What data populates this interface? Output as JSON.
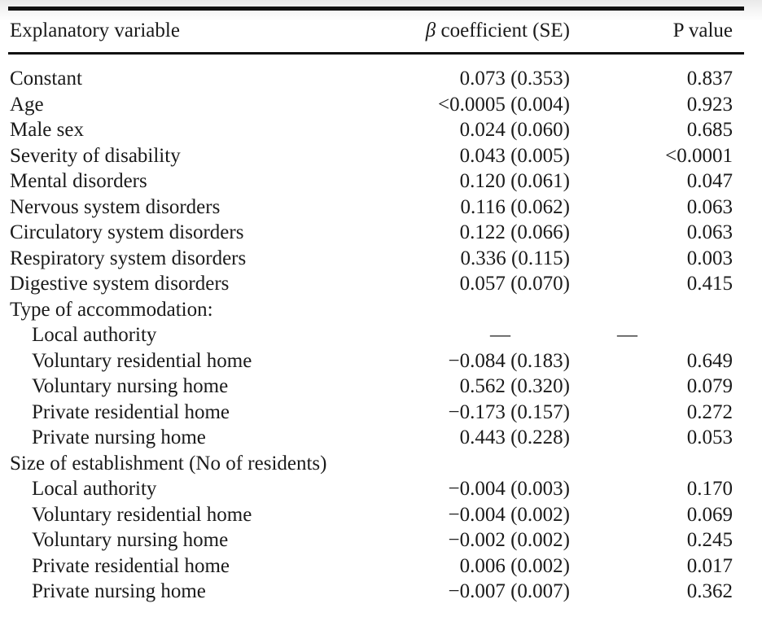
{
  "table": {
    "columns": [
      {
        "key": "variable",
        "label": "Explanatory variable",
        "align": "left"
      },
      {
        "key": "beta",
        "label_prefix": "β",
        "label_rest": " coefficient (SE)",
        "align": "right"
      },
      {
        "key": "p",
        "label": "P value",
        "align": "right"
      }
    ],
    "rows": [
      {
        "variable": "Constant",
        "indent": false,
        "beta": "0.073 (0.353)",
        "p": "0.837"
      },
      {
        "variable": "Age",
        "indent": false,
        "beta": "<0.0005 (0.004)",
        "p": "0.923"
      },
      {
        "variable": "Male sex",
        "indent": false,
        "beta": "0.024 (0.060)",
        "p": "0.685"
      },
      {
        "variable": "Severity of disability",
        "indent": false,
        "beta": "0.043 (0.005)",
        "p": "<0.0001"
      },
      {
        "variable": "Mental disorders",
        "indent": false,
        "beta": "0.120 (0.061)",
        "p": "0.047"
      },
      {
        "variable": "Nervous system disorders",
        "indent": false,
        "beta": "0.116 (0.062)",
        "p": "0.063"
      },
      {
        "variable": "Circulatory system disorders",
        "indent": false,
        "beta": "0.122 (0.066)",
        "p": "0.063"
      },
      {
        "variable": "Respiratory system disorders",
        "indent": false,
        "beta": "0.336 (0.115)",
        "p": "0.003"
      },
      {
        "variable": "Digestive system disorders",
        "indent": false,
        "beta": "0.057 (0.070)",
        "p": "0.415"
      },
      {
        "variable": "Type of accommodation:",
        "indent": false,
        "beta": "",
        "p": ""
      },
      {
        "variable": "Local authority",
        "indent": true,
        "beta": "—",
        "p": "—"
      },
      {
        "variable": "Voluntary residential home",
        "indent": true,
        "beta": "−0.084 (0.183)",
        "p": "0.649"
      },
      {
        "variable": "Voluntary nursing home",
        "indent": true,
        "beta": "0.562 (0.320)",
        "p": "0.079"
      },
      {
        "variable": "Private residential home",
        "indent": true,
        "beta": "−0.173 (0.157)",
        "p": "0.272"
      },
      {
        "variable": "Private nursing home",
        "indent": true,
        "beta": "0.443 (0.228)",
        "p": "0.053"
      },
      {
        "variable": "Size of establishment (No of residents)",
        "indent": false,
        "beta": "",
        "p": ""
      },
      {
        "variable": "Local authority",
        "indent": true,
        "beta": "−0.004 (0.003)",
        "p": "0.170"
      },
      {
        "variable": "Voluntary residential home",
        "indent": true,
        "beta": "−0.004 (0.002)",
        "p": "0.069"
      },
      {
        "variable": "Voluntary nursing home",
        "indent": true,
        "beta": "−0.002 (0.002)",
        "p": "0.245"
      },
      {
        "variable": "Private residential home",
        "indent": true,
        "beta": "0.006 (0.002)",
        "p": "0.017"
      },
      {
        "variable": "Private nursing home",
        "indent": true,
        "beta": "−0.007 (0.007)",
        "p": "0.362"
      }
    ]
  },
  "colors": {
    "rule": "#111111",
    "text": "#1a1a1a",
    "background": "#ffffff"
  }
}
